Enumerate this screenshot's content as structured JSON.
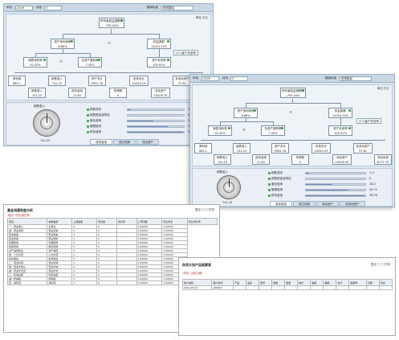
{
  "win1": {
    "toolbar": {
      "label1": "年份",
      "year": "2009",
      "label2": "月份",
      "month": "3",
      "label3": "模拟标准",
      "standard": "常规模拟"
    },
    "unit": "单位:万元",
    "nodes": {
      "roe": {
        "label": "所有者权益报酬率",
        "value": "-793.44%"
      },
      "roa": {
        "label": "资产净利润率",
        "value": "8.66%"
      },
      "multiplier": {
        "label": "权益乘数",
        "value": "11010.22%"
      },
      "margin": {
        "label": "销售净利率",
        "value": "92.43%"
      },
      "turnover": {
        "label": "总资产周转率",
        "value": "7.45%"
      },
      "debt": {
        "label": "资产负债率",
        "value": "100.91%"
      },
      "net_profit": {
        "label": "净利润",
        "value": "685.1"
      },
      "sales1": {
        "label": "销售收入",
        "value": "741.23"
      },
      "sales2": {
        "label": "销售收入",
        "value": "741.23"
      },
      "total_assets": {
        "label": "资产总计",
        "value": "9952.76"
      },
      "liab": {
        "label": "负债总计",
        "value": "10043.29"
      },
      "income": {
        "label": "收入合计",
        "value": "741.23"
      },
      "cost": {
        "label": "成本费用",
        "value": "27.83"
      },
      "tax": {
        "label": "所得税",
        "value": "0"
      },
      "current": {
        "label": "流动资产",
        "value": "10009.30"
      },
      "noncurrent": {
        "label": "非流动资产",
        "value": "37.81"
      },
      "cur_liab": {
        "label": "流动负债",
        "value": "6772.75"
      }
    },
    "note": "LF1:客户负债率",
    "gauge_label": "销售收入",
    "gauge_value": "741.23",
    "legend": [
      {
        "label": "销售成本",
        "value": "1.3",
        "color": "#3a9a3a",
        "fill": 0.05
      },
      {
        "label": "销售税金及附加",
        "value": "0",
        "color": "#3a9a3a",
        "fill": 0.0
      },
      {
        "label": "营业费用",
        "value": "16.2",
        "color": "#3a9a3a",
        "fill": 0.45
      },
      {
        "label": "管理费用",
        "value": "26.72",
        "color": "#3a9a3a",
        "fill": 0.72
      },
      {
        "label": "财务费用",
        "value": "36.79",
        "color": "#3a9a3a",
        "fill": 0.98
      }
    ],
    "tabs": [
      "成本费用",
      "其它利润",
      "流动资产",
      "非流动资产"
    ]
  },
  "sheet1": {
    "title": "基金流通收益分析",
    "controls": "显示 □ □ 打印",
    "red_text": "·增长 ·同比增长率",
    "headers": [
      "项目",
      "本期金额",
      "上期金额",
      "增长额",
      "增长率",
      "上年同期",
      "同比增长",
      "同比增长率"
    ],
    "rows": [
      [
        "一、营业收入",
        "主营业",
        "1",
        "0",
        "",
        "1.00000",
        "1.00000"
      ],
      [
        "减：营业成本",
        "营业成本",
        "1",
        "0",
        "",
        "1.00000",
        "1.00000"
      ],
      [
        "营业税金",
        "营业税金",
        "1",
        "0",
        "",
        "1.00000",
        "1.00000"
      ],
      [
        "营业费用",
        "营业费用",
        "1",
        "0",
        "",
        "1.00000",
        "1.00000"
      ],
      [
        "管理费用",
        "管理费用",
        "1",
        "0",
        "",
        "1.00000",
        "1.00000"
      ],
      [
        "财务费用",
        "财务费用",
        "1",
        "0",
        "",
        "1.00000",
        "1.00000"
      ],
      [
        "资产减值损失",
        "资产减值",
        "1",
        "0",
        "",
        "1.00000",
        "1.00000"
      ],
      [
        "加：公允价值",
        "公允价值",
        "1",
        "0",
        "",
        "1.00000",
        "1.00000"
      ],
      [
        "投资收益",
        "投资收益",
        "1",
        "0",
        "",
        "1.00000",
        "1.00000"
      ],
      [
        "二、营业利润",
        "营业利润",
        "1",
        "0",
        "",
        "1.00000",
        "1.00000"
      ],
      [
        "加：营业外收入",
        "营业外收",
        "1",
        "0",
        "",
        "1.00000",
        "1.00000"
      ],
      [
        "减：营业外支出",
        "营业外支",
        "1",
        "0",
        "",
        "1.00000",
        "1.00000"
      ],
      [
        "三、利润总额",
        "利润总额",
        "1",
        "0",
        "",
        "1.00000",
        "1.00000"
      ],
      [
        "减：所得税",
        "所得税",
        "1",
        "0",
        "",
        "1.00000",
        "1.00000"
      ],
      [
        "四、净利润",
        "净利润",
        "1",
        "0",
        "",
        "1.00000",
        "1.00000"
      ]
    ]
  },
  "sheet2": {
    "title": "存货计划产品结算表",
    "controls": "显示 □ □ 打印",
    "red_text": "·状态  ·当前日期",
    "headers": [
      "客户编码",
      "客户名称",
      "产品",
      "品名",
      "型号",
      "规格",
      "数量",
      "单价",
      "金额",
      "税额",
      "合计",
      "发票号",
      "日期",
      "状态"
    ],
    "rows": [
      [
        "2010-03-01",
        "A00001",
        "",
        "",
        "",
        "",
        "",
        "",
        "",
        "",
        "",
        "",
        "",
        ""
      ]
    ]
  }
}
